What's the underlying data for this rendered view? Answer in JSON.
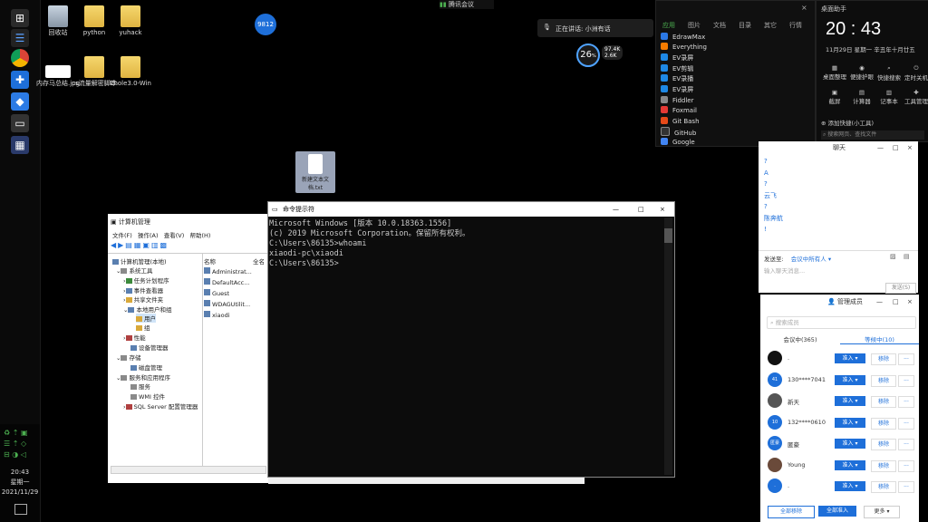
{
  "desktop": {
    "icons": [
      {
        "label": "回收站",
        "name": "recycle-bin-icon"
      },
      {
        "label": "python",
        "name": "python-folder-icon"
      },
      {
        "label": "yuhack",
        "name": "yuhack-folder-icon"
      },
      {
        "label": "内存马总结.jpg",
        "name": "image-file-icon"
      },
      {
        "label": "cs流量解密脚本",
        "name": "cs-script-folder-icon"
      },
      {
        "label": "Ehole3.0-Win",
        "name": "ehole-folder-icon"
      },
      {
        "label": "新建文本文档.txt",
        "name": "text-file-icon"
      }
    ],
    "badge": "9812"
  },
  "top_bar": {
    "meeting": "腾讯会议",
    "mic_text": "正在讲话: 小洲有话"
  },
  "speed_widget": {
    "percent": "26",
    "unit": "%",
    "up": "97.4K",
    "down": "2.6K"
  },
  "apps_panel": {
    "tabs": [
      "应用",
      "图片",
      "文档",
      "目录",
      "其它",
      "行情"
    ],
    "items": [
      "EdrawMax",
      "Everything",
      "EV录屏",
      "EV剪辑",
      "EV录播",
      "EV录屏",
      "Fiddler",
      "Foxmail",
      "Git Bash",
      "GitHub",
      "Google"
    ]
  },
  "clock_panel": {
    "title": "桌面助手",
    "time": "20 : 43",
    "date": "11月29日",
    "weekday": "星期一",
    "lunar": "辛丑年十月廿五",
    "quick": [
      "桌面整理",
      "便捷护眼",
      "快捷搜索",
      "定时关机",
      "截屏",
      "计算器",
      "记事本",
      "工具管理"
    ],
    "add_btn": "添加快捷(小工具)",
    "search_placeholder": "搜索网页、查找文件"
  },
  "chat_panel": {
    "title": "聊天",
    "messages": [
      "?",
      "A",
      "?",
      "云飞",
      "?",
      "陈奔航",
      "!"
    ],
    "send_to_label": "发送至:",
    "send_to_value": "会议中所有人",
    "input_placeholder": "输入聊天消息...",
    "send_btn": "发送(S)"
  },
  "member_panel": {
    "title": "管理成员",
    "search_placeholder": "搜索成员",
    "tab_in": "会议中(365)",
    "tab_wait": "等候中(10)",
    "members": [
      {
        "name": ".",
        "color": "#111",
        "initial": ""
      },
      {
        "name": "130****7041",
        "color": "#1e6fd9",
        "initial": "41"
      },
      {
        "name": "新天",
        "color": "#555",
        "initial": ""
      },
      {
        "name": "132****0610",
        "color": "#1e6fd9",
        "initial": "10"
      },
      {
        "name": "匿豪",
        "color": "#1e6fd9",
        "initial": "匿豪"
      },
      {
        "name": "Young",
        "color": "#6a4a3a",
        "initial": ""
      },
      {
        "name": ".",
        "color": "#1e6fd9",
        "initial": "."
      }
    ],
    "btn_admit": "准入",
    "btn_remove": "移除",
    "footer_remove_all": "全部移除",
    "footer_admit_all": "全部准入",
    "footer_more": "更多"
  },
  "cmd_window": {
    "title": "命令提示符",
    "lines": [
      "Microsoft Windows [版本 10.0.18363.1556]",
      "(c) 2019 Microsoft Corporation。保留所有权利。",
      "",
      "C:\\Users\\86135>whoami",
      "xiaodi-pc\\xiaodi",
      "",
      "C:\\Users\\86135>"
    ]
  },
  "mgmt_window": {
    "title": "计算机管理",
    "menu": [
      "文件(F)",
      "操作(A)",
      "查看(V)",
      "帮助(H)"
    ],
    "tree": [
      "计算机管理(本地)",
      "系统工具",
      "任务计划程序",
      "事件查看器",
      "共享文件夹",
      "本地用户和组",
      "用户",
      "组",
      "性能",
      "设备管理器",
      "存储",
      "磁盘管理",
      "服务和应用程序",
      "服务",
      "WMI 控件",
      "SQL Server 配置管理器"
    ],
    "col_name": "名称",
    "col_full": "全名",
    "users": [
      "Administrat...",
      "DefaultAcc...",
      "Guest",
      "WDAGUtilit...",
      "xiaodi"
    ]
  },
  "tray": {
    "time": "20:43",
    "weekday": "星期一",
    "date": "2021/11/29"
  },
  "colors": {
    "accent": "#1e6fd9",
    "cmd_bg": "#0c0c0c",
    "cmd_text": "#c8c8c8"
  }
}
